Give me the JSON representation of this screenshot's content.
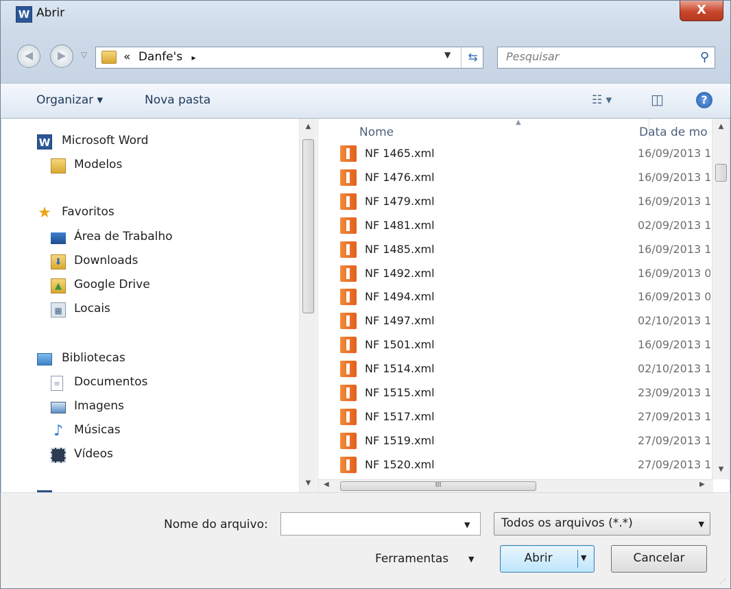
{
  "window": {
    "title": "Abrir",
    "app_icon": "word-icon",
    "close_label": "X"
  },
  "address": {
    "breadcrumb_chevron": "«",
    "path": "Danfe's",
    "path_arrow": "▸",
    "dropdown": "▼",
    "refresh_glyph": "⇆"
  },
  "search": {
    "placeholder": "Pesquisar",
    "icon": "search-icon"
  },
  "toolbar": {
    "organize": "Organizar ▾",
    "new_folder": "Nova pasta",
    "view_glyph": "☷ ▾",
    "pane_glyph": "◫",
    "help_glyph": "?"
  },
  "nav": {
    "items": [
      {
        "label": "Microsoft Word",
        "icon": "word-icon"
      },
      {
        "label": "Modelos",
        "icon": "folder-icon"
      },
      {
        "label": "Favoritos",
        "icon": "star-icon"
      },
      {
        "label": "Área de Trabalho",
        "icon": "desktop-icon"
      },
      {
        "label": "Downloads",
        "icon": "downloads-folder-icon"
      },
      {
        "label": "Google Drive",
        "icon": "google-drive-icon"
      },
      {
        "label": "Locais",
        "icon": "recent-places-icon"
      },
      {
        "label": "Bibliotecas",
        "icon": "libraries-icon"
      },
      {
        "label": "Documentos",
        "icon": "documents-icon"
      },
      {
        "label": "Imagens",
        "icon": "pictures-icon"
      },
      {
        "label": "Músicas",
        "icon": "music-icon"
      },
      {
        "label": "Vídeos",
        "icon": "videos-icon"
      }
    ]
  },
  "list": {
    "columns": {
      "name": "Nome",
      "date": "Data de mo"
    },
    "files": [
      {
        "name": "NF 1465.xml",
        "date": "16/09/2013 1"
      },
      {
        "name": "NF 1476.xml",
        "date": "16/09/2013 1"
      },
      {
        "name": "NF 1479.xml",
        "date": "16/09/2013 1"
      },
      {
        "name": "NF 1481.xml",
        "date": "02/09/2013 1"
      },
      {
        "name": "NF 1485.xml",
        "date": "16/09/2013 1"
      },
      {
        "name": "NF 1492.xml",
        "date": "16/09/2013 0"
      },
      {
        "name": "NF 1494.xml",
        "date": "16/09/2013 0"
      },
      {
        "name": "NF 1497.xml",
        "date": "02/10/2013 1"
      },
      {
        "name": "NF 1501.xml",
        "date": "16/09/2013 1"
      },
      {
        "name": "NF 1514.xml",
        "date": "02/10/2013 1"
      },
      {
        "name": "NF 1515.xml",
        "date": "23/09/2013 1"
      },
      {
        "name": "NF 1517.xml",
        "date": "27/09/2013 1"
      },
      {
        "name": "NF 1519.xml",
        "date": "27/09/2013 1"
      },
      {
        "name": "NF 1520.xml",
        "date": "27/09/2013 1"
      }
    ],
    "hscroll_grip": "III"
  },
  "footer": {
    "filename_label": "Nome do arquivo:",
    "filename_value": "",
    "filetype": "Todos os arquivos (*.*)",
    "tools": "Ferramentas",
    "open": "Abrir",
    "cancel": "Cancelar",
    "dropdown": "▼"
  }
}
